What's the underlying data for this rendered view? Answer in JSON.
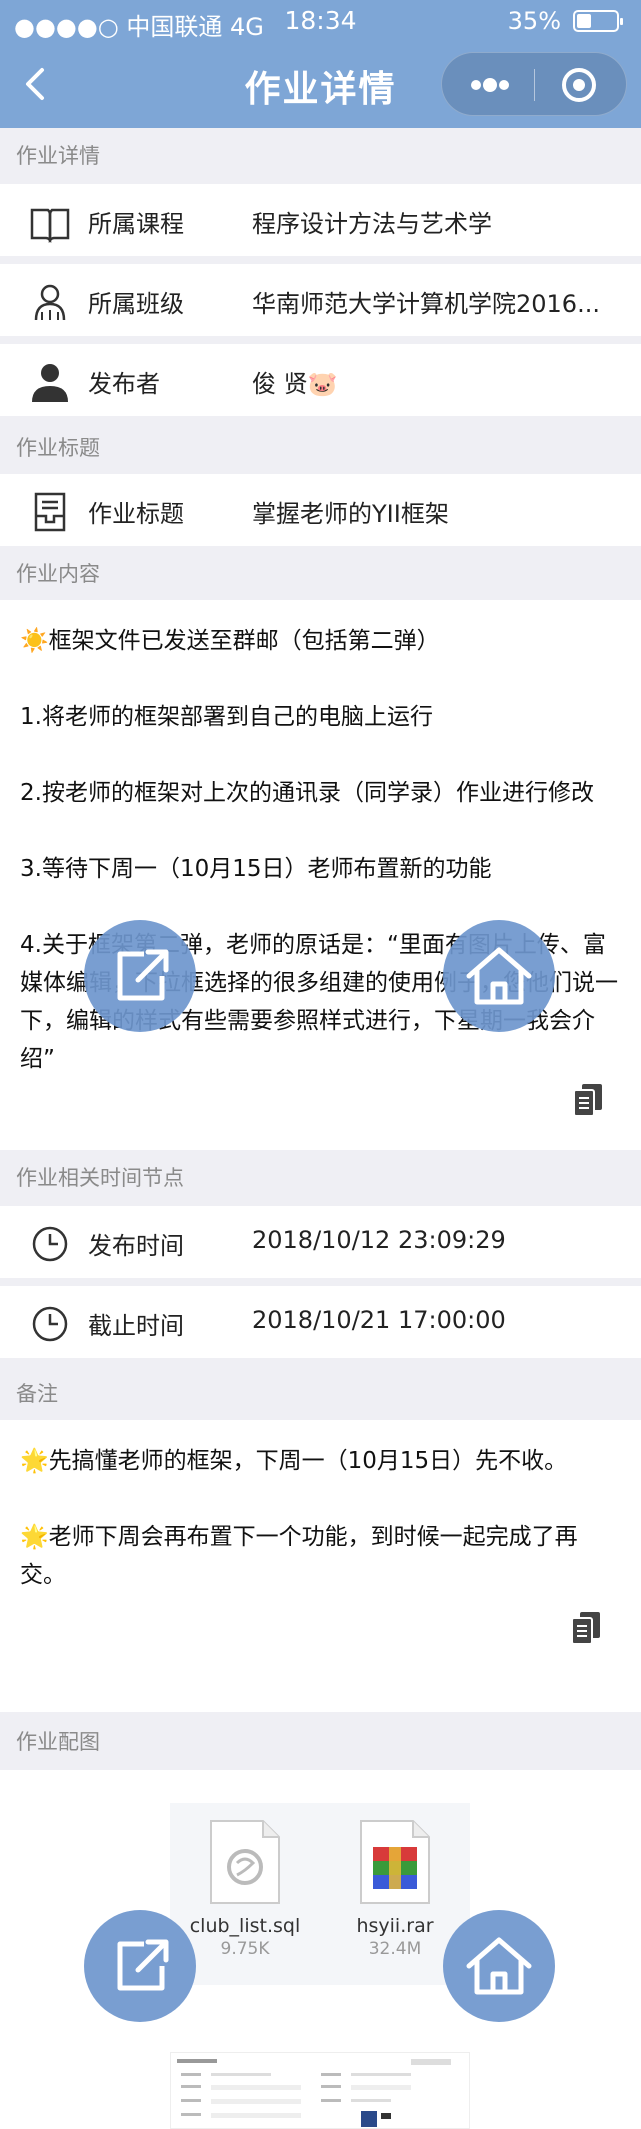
{
  "status_bar": {
    "carrier": "中国联通",
    "network": "4G",
    "time": "18:34",
    "battery": "35%"
  },
  "nav": {
    "title": "作业详情"
  },
  "sections": {
    "detail": "作业详情",
    "title": "作业标题",
    "content": "作业内容",
    "time": "作业相关时间节点",
    "remark": "备注",
    "images": "作业配图"
  },
  "detail_rows": [
    {
      "label": "所属课程",
      "value": "程序设计方法与艺术学",
      "icon": "book-icon"
    },
    {
      "label": "所属班级",
      "value": "华南师范大学计算机学院2016...",
      "icon": "class-icon"
    },
    {
      "label": "发布者",
      "value": "俊 贤🐷",
      "icon": "person-icon"
    }
  ],
  "title_row": {
    "label": "作业标题",
    "value": "掌握老师的YII框架",
    "icon": "document-icon"
  },
  "content_paragraphs": [
    "☀️框架文件已发送至群邮（包括第二弹）",
    "1.将老师的框架部署到自己的电脑上运行",
    "2.按老师的框架对上次的通讯录（同学录）作业进行修改",
    "3.等待下周一（10月15日）老师布置新的功能",
    "4.关于框架第二弹，老师的原话是：“里面有图片上传、富媒体编辑，下拉框选择的很多组建的使用例子，您他们说一下，编辑的样式有些需要参照样式进行，下星期一我会介绍”"
  ],
  "time_rows": [
    {
      "label": "发布时间",
      "value": "2018/10/12 23:09:29",
      "icon": "clock-icon"
    },
    {
      "label": "截止时间",
      "value": "2018/10/21 17:00:00",
      "icon": "clock-icon"
    }
  ],
  "remark_paragraphs": [
    "🌟先搞懂老师的框架，下周一（10月15日）先不收。",
    "🌟老师下周会再布置下一个功能，到时候一起完成了再交。"
  ],
  "attachments": [
    {
      "name": "club_list.sql",
      "size": "9.75K",
      "icon": "sql-file-icon"
    },
    {
      "name": "hsyii.rar",
      "size": "32.4M",
      "icon": "rar-file-icon"
    }
  ],
  "colors": {
    "nav_bg": "#7ea6d6",
    "float_btn": "#6e96cd"
  }
}
